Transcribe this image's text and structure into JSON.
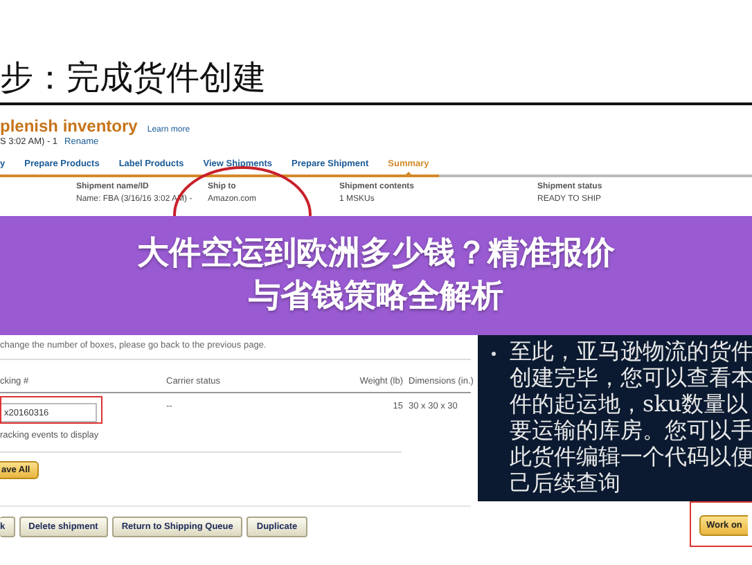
{
  "slide_heading": "步：完成货件创建",
  "page": {
    "title": "plenish inventory",
    "learn_more": "Learn more",
    "subtitle": "S 3:02 AM) - 1",
    "rename": "Rename"
  },
  "tabs": [
    {
      "label": "y",
      "selected": false
    },
    {
      "label": "Prepare Products",
      "selected": false
    },
    {
      "label": "Label Products",
      "selected": false
    },
    {
      "label": "View Shipments",
      "selected": false
    },
    {
      "label": "Prepare Shipment",
      "selected": false
    },
    {
      "label": "Summary",
      "selected": true
    }
  ],
  "summary_columns": [
    {
      "heading": "Shipment name/ID",
      "value": "Name: FBA (3/16/16 3:02 AM) -"
    },
    {
      "heading": "Ship to",
      "value": "Amazon.com"
    },
    {
      "heading": "Shipment contents",
      "value": "1 MSKUs"
    },
    {
      "heading": "Shipment status",
      "value": "READY TO SHIP"
    }
  ],
  "banner": {
    "lines": [
      "大件空运到欧洲多少钱？精准报价",
      "与省钱策略全解析"
    ]
  },
  "notice": "change the number of boxes, please go back to the previous page.",
  "boxes_table": {
    "columns": [
      "cking #",
      "Carrier status",
      "Weight (lb)",
      "Dimensions (in.)"
    ],
    "rows": [
      {
        "tracking": "x20160316",
        "carrier_status": "--",
        "weight": "15",
        "dimensions": "30 x 30 x 30"
      }
    ],
    "note": "racking events to display"
  },
  "save_button": "ave All",
  "action_buttons": [
    "k",
    "Delete shipment",
    "Return to Shipping Queue",
    "Duplicate"
  ],
  "callout": {
    "lines": [
      "至此，亚马逊物流的货件",
      "创建完毕，您可以查看本",
      "件的起运地，sku数量以",
      "要运输的库房。您可以手",
      "此货件编辑一个代码以便",
      "己后续查询"
    ]
  },
  "work_on_button": "Work on"
}
